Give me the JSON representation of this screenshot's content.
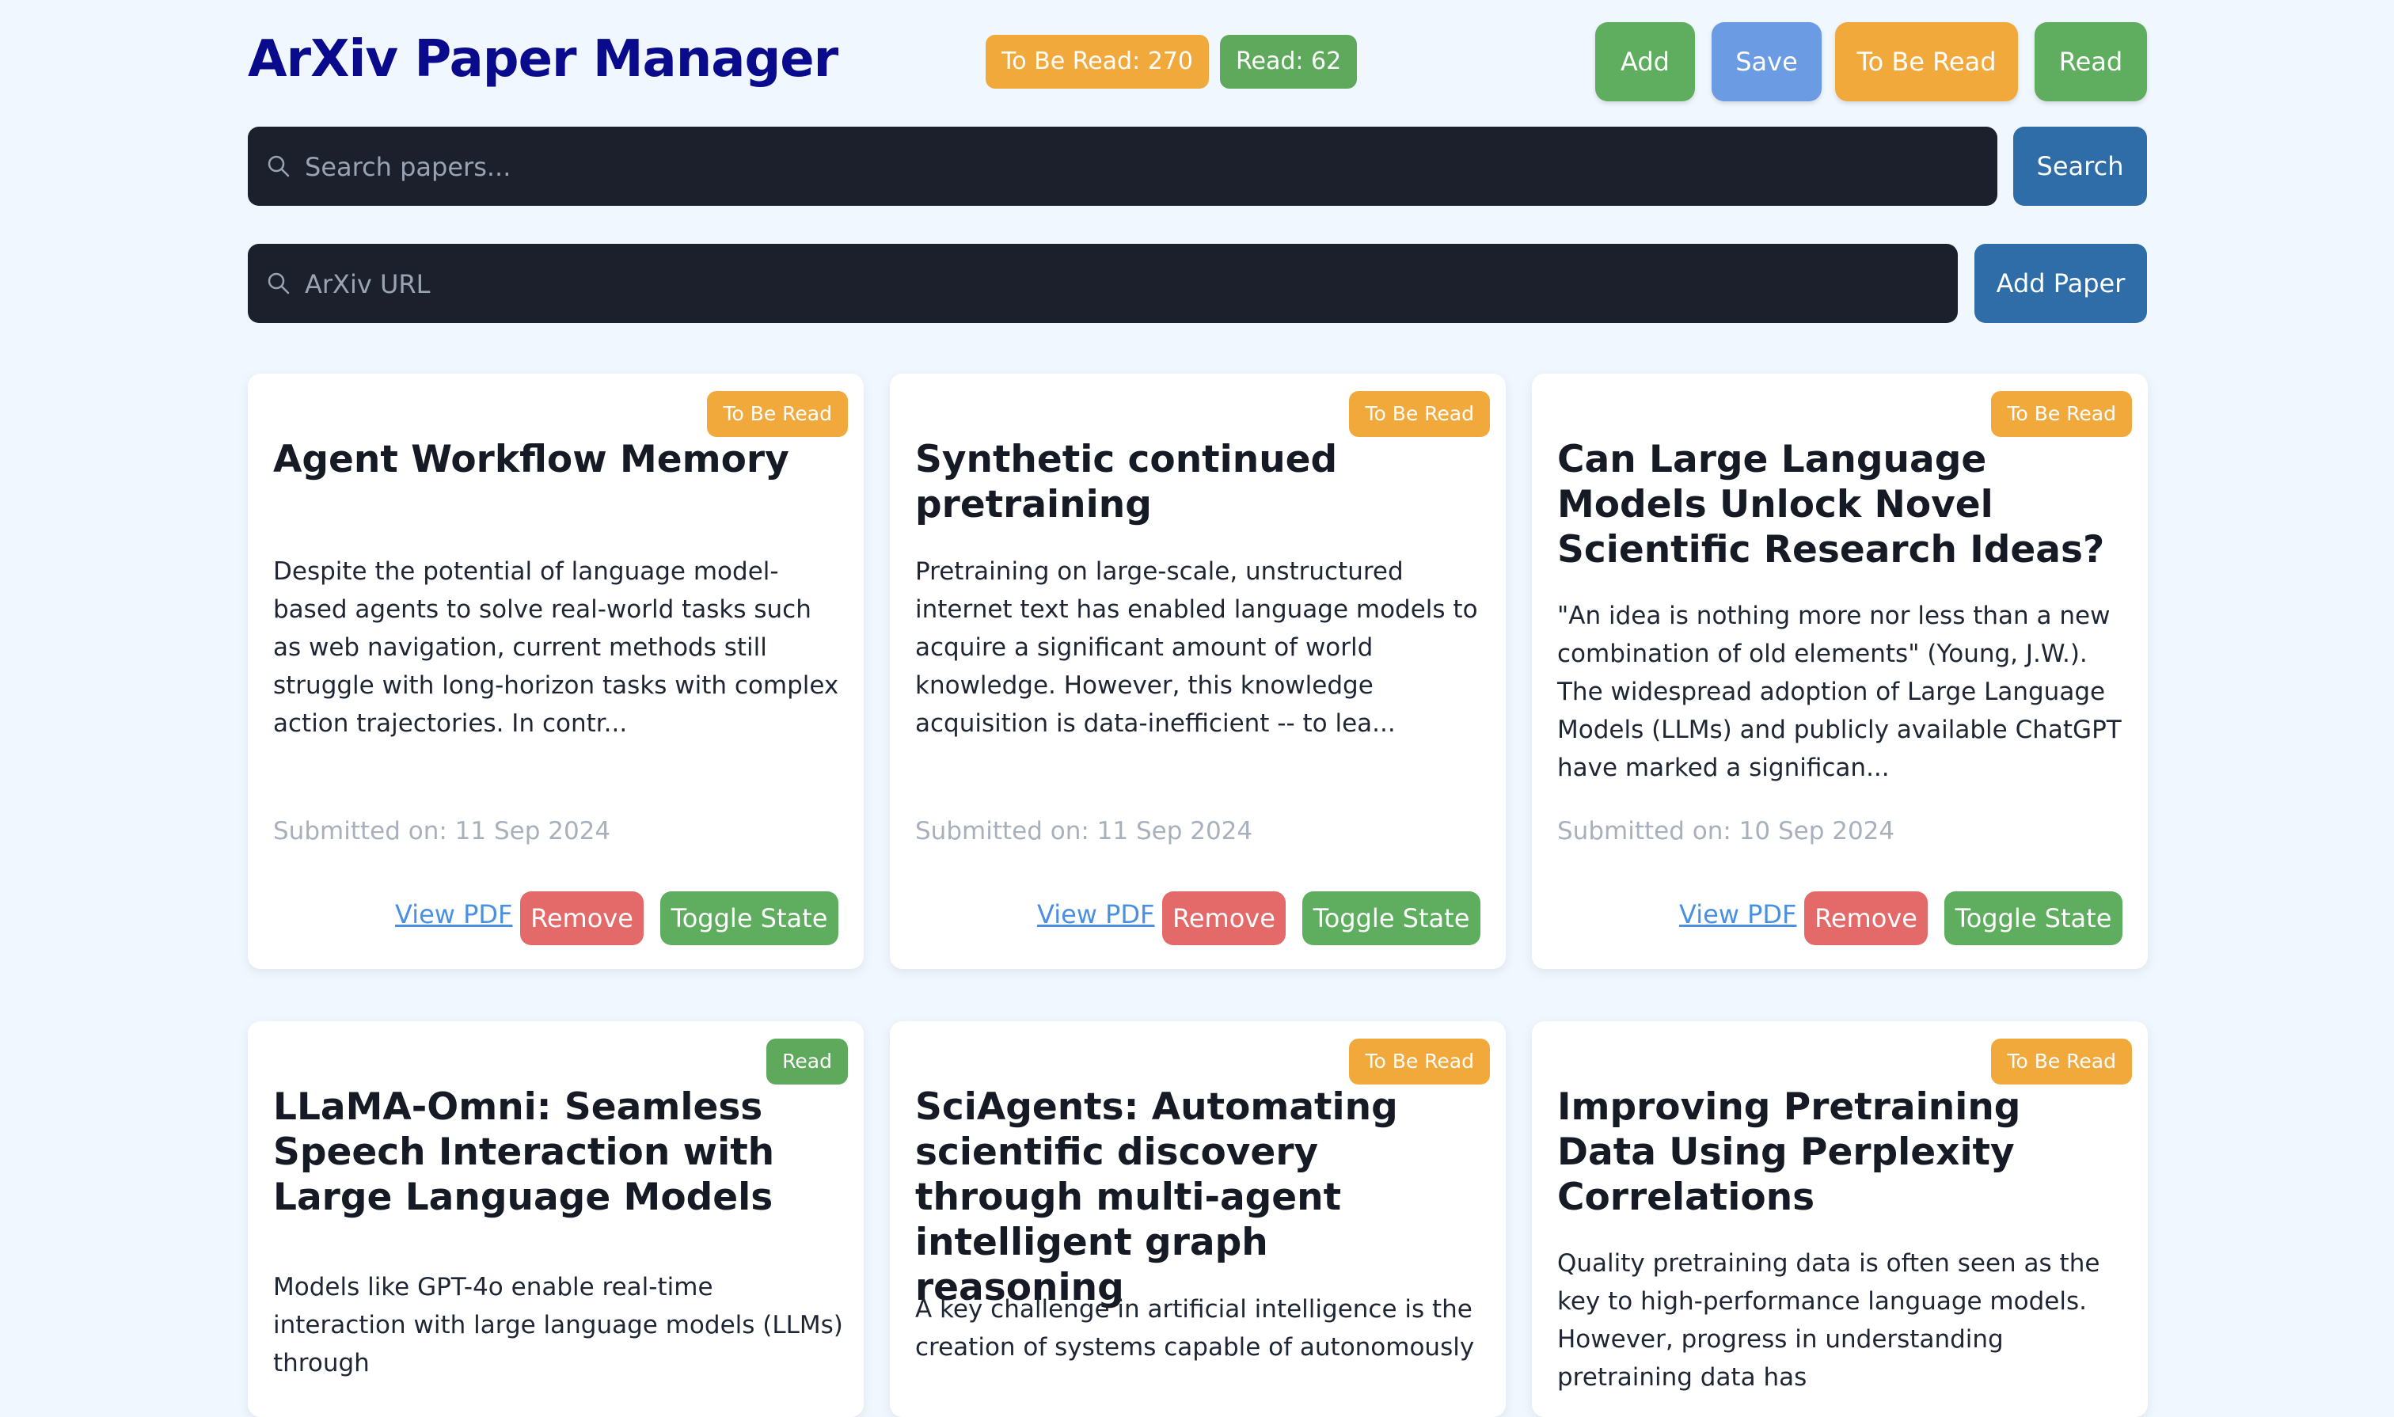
{
  "header": {
    "title": "ArXiv Paper Manager",
    "counters": {
      "to_be_read": "To Be Read: 270",
      "read": "Read: 62"
    },
    "buttons": {
      "add": "Add",
      "save": "Save",
      "to_be_read": "To Be Read",
      "read": "Read"
    }
  },
  "search": {
    "placeholder": "Search papers...",
    "button": "Search",
    "icon": "search-icon"
  },
  "add_url": {
    "placeholder": "ArXiv URL",
    "button": "Add Paper",
    "icon": "search-icon"
  },
  "colors": {
    "background": "#f0f7ff",
    "title": "#0a0a8c",
    "to_be_read": "#f2a93b",
    "read": "#5fa95c",
    "save": "#6a9be3",
    "primary": "#2e6da8",
    "remove": "#e46a6a",
    "input_bg": "#1b202c"
  },
  "papers": [
    {
      "status": "To Be Read",
      "title": "Agent Workflow Memory",
      "abstract": "Despite the potential of language model-based agents to solve real-world tasks such as web navigation, current methods still struggle with long-horizon tasks with complex action trajectories. In contr...",
      "date": "Submitted on: 11 Sep 2024",
      "view_pdf": "View PDF",
      "remove": "Remove",
      "toggle": "Toggle State"
    },
    {
      "status": "To Be Read",
      "title": "Synthetic continued pretraining",
      "abstract": "Pretraining on large-scale, unstructured internet text has enabled language models to acquire a significant amount of world knowledge. However, this knowledge acquisition is data-inefficient -- to lea...",
      "date": "Submitted on: 11 Sep 2024",
      "view_pdf": "View PDF",
      "remove": "Remove",
      "toggle": "Toggle State"
    },
    {
      "status": "To Be Read",
      "title": "Can Large Language Models Unlock Novel Scientific Research Ideas?",
      "abstract": "\"An idea is nothing more nor less than a new combination of old elements\" (Young, J.W.). The widespread adoption of Large Language Models (LLMs) and publicly available ChatGPT have marked a significan...",
      "date": "Submitted on: 10 Sep 2024",
      "view_pdf": "View PDF",
      "remove": "Remove",
      "toggle": "Toggle State"
    },
    {
      "status": "Read",
      "title": "LLaMA-Omni: Seamless Speech Interaction with Large Language Models",
      "abstract": "Models like GPT-4o enable real-time interaction with large language models (LLMs) through"
    },
    {
      "status": "To Be Read",
      "title": "SciAgents: Automating scientific discovery through multi-agent intelligent graph reasoning",
      "abstract": "A key challenge in artificial intelligence is the creation of systems capable of autonomously"
    },
    {
      "status": "To Be Read",
      "title": "Improving Pretraining Data Using Perplexity Correlations",
      "abstract": "Quality pretraining data is often seen as the key to high-performance language models. However, progress in understanding pretraining data has"
    }
  ]
}
